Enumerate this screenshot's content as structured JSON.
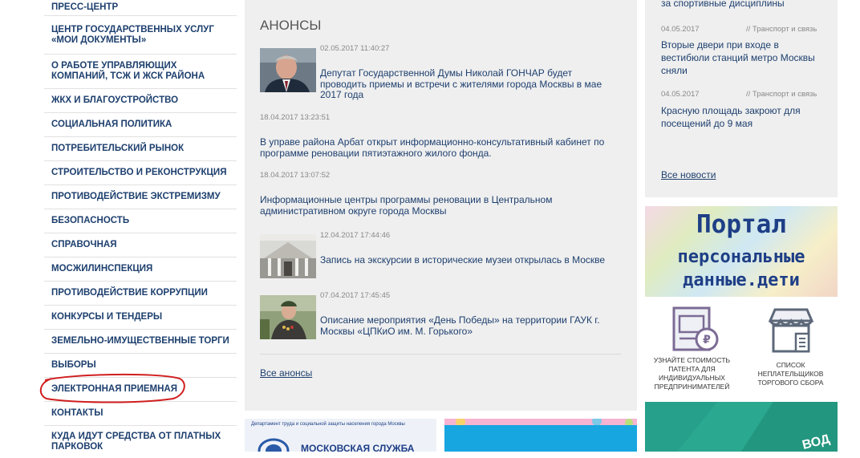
{
  "sidebar": {
    "items": [
      {
        "label": "ПРЕСС-ЦЕНТР"
      },
      {
        "label": "ЦЕНТР ГОСУДАРСТВЕННЫХ УСЛУГ «МОИ ДОКУМЕНТЫ»"
      },
      {
        "label": "О РАБОТЕ УПРАВЛЯЮЩИХ КОМПАНИЙ, ТСЖ И ЖСК РАЙОНА"
      },
      {
        "label": "ЖКХ И БЛАГОУСТРОЙСТВО"
      },
      {
        "label": "СОЦИАЛЬНАЯ ПОЛИТИКА"
      },
      {
        "label": "ПОТРЕБИТЕЛЬСКИЙ РЫНОК"
      },
      {
        "label": "СТРОИТЕЛЬСТВО И РЕКОНСТРУКЦИЯ"
      },
      {
        "label": "ПРОТИВОДЕЙСТВИЕ ЭКСТРЕМИЗМУ"
      },
      {
        "label": "БЕЗОПАСНОСТЬ"
      },
      {
        "label": "СПРАВОЧНАЯ"
      },
      {
        "label": "МОСЖИЛИНСПЕКЦИЯ"
      },
      {
        "label": "ПРОТИВОДЕЙСТВИЕ КОРРУПЦИИ"
      },
      {
        "label": "КОНКУРСЫ И ТЕНДЕРЫ"
      },
      {
        "label": "ЗЕМЕЛЬНО-ИМУЩЕСТВЕННЫЕ ТОРГИ"
      },
      {
        "label": "ВЫБОРЫ"
      },
      {
        "label": "ЭЛЕКТРОННАЯ ПРИЕМНАЯ"
      },
      {
        "label": "КОНТАКТЫ"
      },
      {
        "label": "КУДА ИДУТ СРЕДСТВА ОТ ПЛАТНЫХ ПАРКОВОК"
      }
    ]
  },
  "anons": {
    "title": "АНОНСЫ",
    "items": [
      {
        "date": "02.05.2017 11:40:27",
        "text": "Депутат Государственной Думы Николай ГОНЧАР будет проводить приемы и встречи с жителями города Москвы в мае 2017 года"
      },
      {
        "date": "18.04.2017 13:23:51",
        "text": "В управе района Арбат открыт информационно-консультативный кабинет по программе реновации пятиэтажного жилого фонда."
      },
      {
        "date": "18.04.2017 13:07:52",
        "text": "Информационные центры программы реновации в Центральном административном округе города Москвы"
      },
      {
        "date": "12.04.2017 17:44:46",
        "text": "Запись на экскурсии в исторические музеи открылась в Москве"
      },
      {
        "date": "07.04.2017 17:45:45",
        "text": "Описание мероприятия «День Победы» на территории ГАУК г. Москвы «ЦПКиО им. М. Горького»"
      }
    ],
    "all_link": "Все анонсы"
  },
  "news": {
    "top_text": "за спортивные дисциплины",
    "items": [
      {
        "date": "04.05.2017",
        "category": "// Транспорт и связь",
        "text": "Вторые двери при входе в вестибюли станций метро Москвы сняли"
      },
      {
        "date": "04.05.2017",
        "category": "// Транспорт и связь",
        "text": "Красную площадь закроют для посещений до 9 мая"
      }
    ],
    "all_link": "Все новости"
  },
  "banners": {
    "portal_line1": "Портал",
    "portal_line2": "персональные",
    "portal_line3": "данные.дети",
    "patent_label": "УЗНАЙТЕ СТОИМОСТЬ ПАТЕНТА ДЛЯ ИНДИВИДУАЛЬНЫХ ПРЕДПРИНИМАТЕЛЕЙ",
    "nonpayers_label": "СПИСОК НЕПЛАТЕЛЬЩИКОВ ТОРГОВОГО СБОРА",
    "labor_dept": "Департамент труда и социальной защиты населения города Москвы",
    "labor_title": "МОСКОВСКАЯ СЛУЖБА",
    "green_text": "ВОД"
  },
  "colors": {
    "link": "#1d3f6e",
    "highlight_circle": "#d01f1f",
    "panel_bg": "#efefef"
  }
}
